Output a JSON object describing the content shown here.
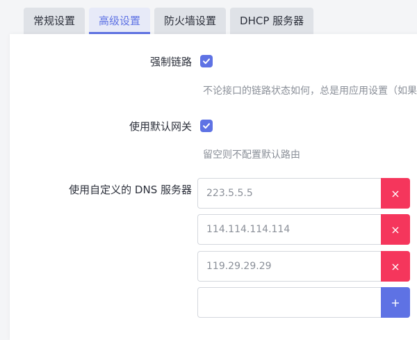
{
  "tabs": [
    {
      "label": "常规设置",
      "active": false
    },
    {
      "label": "高级设置",
      "active": true
    },
    {
      "label": "防火墙设置",
      "active": false
    },
    {
      "label": "DHCP 服务器",
      "active": false
    }
  ],
  "force_link": {
    "label": "强制链路",
    "checked": true,
    "description": "不论接口的链路状态如何，总是用应用设置（如果不"
  },
  "default_gateway": {
    "label": "使用默认网关",
    "checked": true,
    "description": "留空则不配置默认路由"
  },
  "custom_dns": {
    "label": "使用自定义的 DNS 服务器",
    "servers": [
      "223.5.5.5",
      "114.114.114.114",
      "119.29.29.29"
    ],
    "new_value": "",
    "remove_symbol": "×",
    "add_symbol": "+"
  },
  "colors": {
    "accent": "#5e72e4",
    "danger": "#f5365c"
  }
}
